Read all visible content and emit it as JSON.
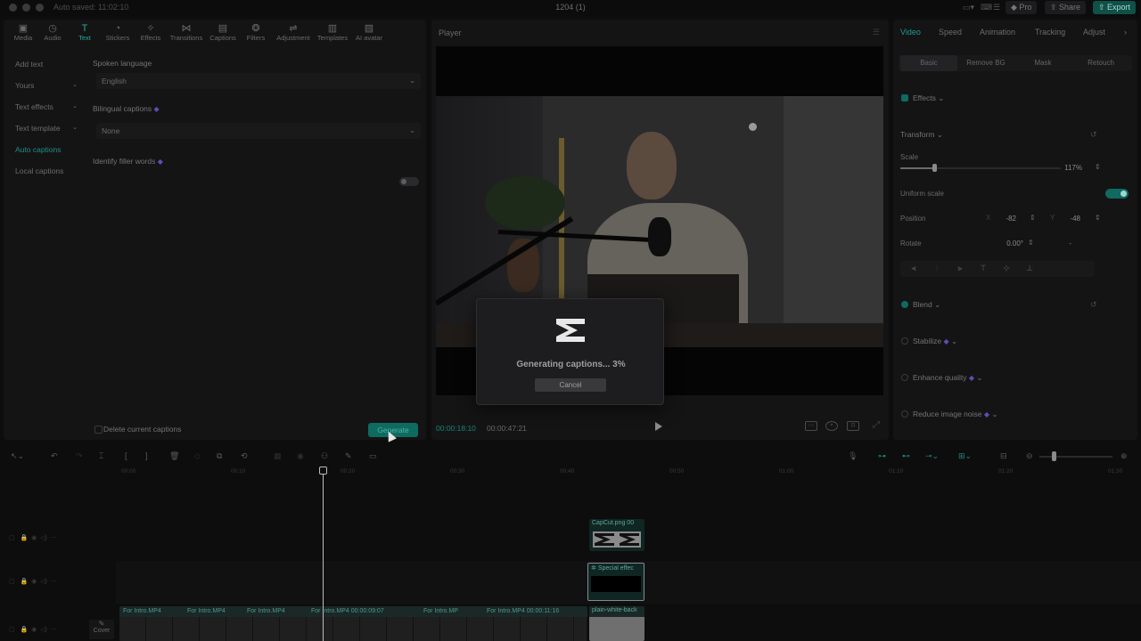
{
  "titlebar": {
    "autosave": "Auto saved: 11:02:10",
    "title": "1204 (1)",
    "pro_label": "Pro",
    "share_label": "Share",
    "export_label": "Export"
  },
  "toolbar": {
    "items": [
      {
        "label": "Media",
        "icon": "media-icon"
      },
      {
        "label": "Audio",
        "icon": "audio-icon"
      },
      {
        "label": "Text",
        "icon": "text-icon",
        "active": true
      },
      {
        "label": "Stickers",
        "icon": "stickers-icon"
      },
      {
        "label": "Effects",
        "icon": "effects-icon"
      },
      {
        "label": "Transitions",
        "icon": "transitions-icon"
      },
      {
        "label": "Captions",
        "icon": "captions-icon"
      },
      {
        "label": "Filters",
        "icon": "filters-icon"
      },
      {
        "label": "Adjustment",
        "icon": "adjustment-icon"
      },
      {
        "label": "Templates",
        "icon": "templates-icon"
      },
      {
        "label": "AI avatar",
        "icon": "ai-avatar-icon"
      }
    ]
  },
  "sidenav": {
    "items": [
      {
        "label": "Add text"
      },
      {
        "label": "Yours"
      },
      {
        "label": "Text effects"
      },
      {
        "label": "Text template"
      },
      {
        "label": "Auto captions",
        "active": true
      },
      {
        "label": "Local captions"
      }
    ]
  },
  "captions": {
    "spoken_language_label": "Spoken language",
    "spoken_language_value": "English",
    "bilingual_label": "Bilingual captions",
    "bilingual_value": "None",
    "filler_label": "Identify filler words",
    "delete_label": "Delete current captions",
    "generate_label": "Generate"
  },
  "player": {
    "title": "Player",
    "current_time": "00:00:18:10",
    "duration": "00:00:47:21"
  },
  "modal": {
    "status": "Generating captions... 3%",
    "cancel_label": "Cancel"
  },
  "inspector": {
    "tabs": [
      "Video",
      "Speed",
      "Animation",
      "Tracking",
      "Adjust"
    ],
    "subtabs": [
      "Basic",
      "Remove BG",
      "Mask",
      "Retouch"
    ],
    "effects_label": "Effects",
    "transform_label": "Transform",
    "scale_label": "Scale",
    "scale_value": "117%",
    "uniform_scale_label": "Uniform scale",
    "position_label": "Position",
    "position_x_label": "X",
    "position_x": "-82",
    "position_y_label": "Y",
    "position_y": "-48",
    "rotate_label": "Rotate",
    "rotate_value": "0.00°",
    "rotate_extra": "-",
    "blend_label": "Blend",
    "stabilize_label": "Stabilize",
    "enhance_label": "Enhance quality",
    "reduce_noise_label": "Reduce image noise"
  },
  "timeline": {
    "ruler": [
      "00:00",
      "00:10",
      "00:20",
      "00:30",
      "00:40",
      "00:50",
      "01:00",
      "01:10",
      "01:20",
      "01:30"
    ],
    "clip_capcut": "CapCut.png  00",
    "clip_effect": "Special effec",
    "main_labels": [
      "For Intro.MP4",
      "For Intro.MP4",
      "For Intro.MP4",
      "For Intro.MP4  00:00:09:07",
      "For Intro.MP",
      "For Intro.MP4  00:00:11:16"
    ],
    "clip_white": "plain-white-back",
    "cover_label": "Cover"
  },
  "colors": {
    "accent": "#1f9b8e",
    "background": "#0d0d0e",
    "panel": "#141415"
  }
}
